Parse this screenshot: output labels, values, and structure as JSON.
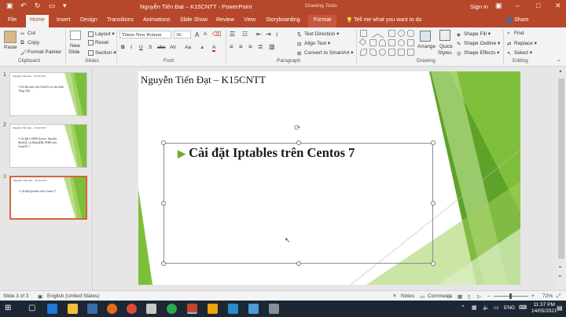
{
  "window": {
    "title": "Nguyễn Tiến Đạt – K15CNTT - PowerPoint",
    "contextual": "Drawing Tools",
    "sign_in": "Sign in"
  },
  "tabs": [
    "File",
    "Home",
    "Insert",
    "Design",
    "Transitions",
    "Animations",
    "Slide Show",
    "Review",
    "View",
    "Storyboarding",
    "Format"
  ],
  "tell_me": "Tell me what you want to do",
  "share": "Share",
  "ribbon": {
    "clipboard": {
      "paste": "Paste",
      "cut": "Cut",
      "copy": "Copy",
      "format_painter": "Format Painter",
      "label": "Clipboard"
    },
    "slides": {
      "new_slide": "New",
      "new_slide2": "Slide",
      "layout": "Layout",
      "reset": "Reset",
      "section": "Section",
      "label": "Slides"
    },
    "font": {
      "name": "Times New Roman",
      "size": "36",
      "label": "Font",
      "bold": "B",
      "italic": "I",
      "underline": "U",
      "strike": "S",
      "abc": "abc",
      "spacing": "AV",
      "case": "Aa",
      "color": "A",
      "grow": "A",
      "shrink": "A"
    },
    "paragraph": {
      "text_direction": "Text Direction",
      "align_text": "Align Text",
      "smartart": "Convert to SmartArt",
      "label": "Paragraph"
    },
    "drawing": {
      "arrange": "Arrange",
      "quick_styles": "Quick",
      "quick_styles2": "Styles",
      "shape_fill": "Shape Fill",
      "shape_outline": "Shape Outline",
      "shape_effects": "Shape Effects",
      "label": "Drawing"
    },
    "editing": {
      "find": "Find",
      "replace": "Replace",
      "select": "Select",
      "label": "Editing"
    }
  },
  "thumbnails": [
    {
      "num": "1",
      "title": "Nguyễn Tiến Đạt – K15CNTT",
      "text": "• Cài đặt máy chủ CentOs và cấu hình Tổng Việt"
    },
    {
      "num": "2",
      "title": "Nguyễn Tiến Đạt – K15CNTT",
      "text": "• Cài đặt LAMP (Linux, Apache, MySQL và MariaDB, PHP) trên CentOS 7"
    },
    {
      "num": "3",
      "title": "Nguyễn Tiến Đạt – K15CNTT",
      "text": "• Cài đặt Iptables trên Centos 7"
    }
  ],
  "slide": {
    "header": "Nguyễn Tiến Đạt – K15CNTT",
    "bullet": "Cài đặt Iptables trên Centos 7"
  },
  "status": {
    "slide_of": "Slide 3 of 3",
    "language": "English (United States)",
    "notes": "Notes",
    "comments": "Comments",
    "zoom": "72%"
  },
  "taskbar": {
    "lang": "ENG",
    "time": "11:37 PM",
    "date": "14/05/2021"
  },
  "colors": {
    "accent": "#b7472a",
    "green": "#6fae2d"
  }
}
